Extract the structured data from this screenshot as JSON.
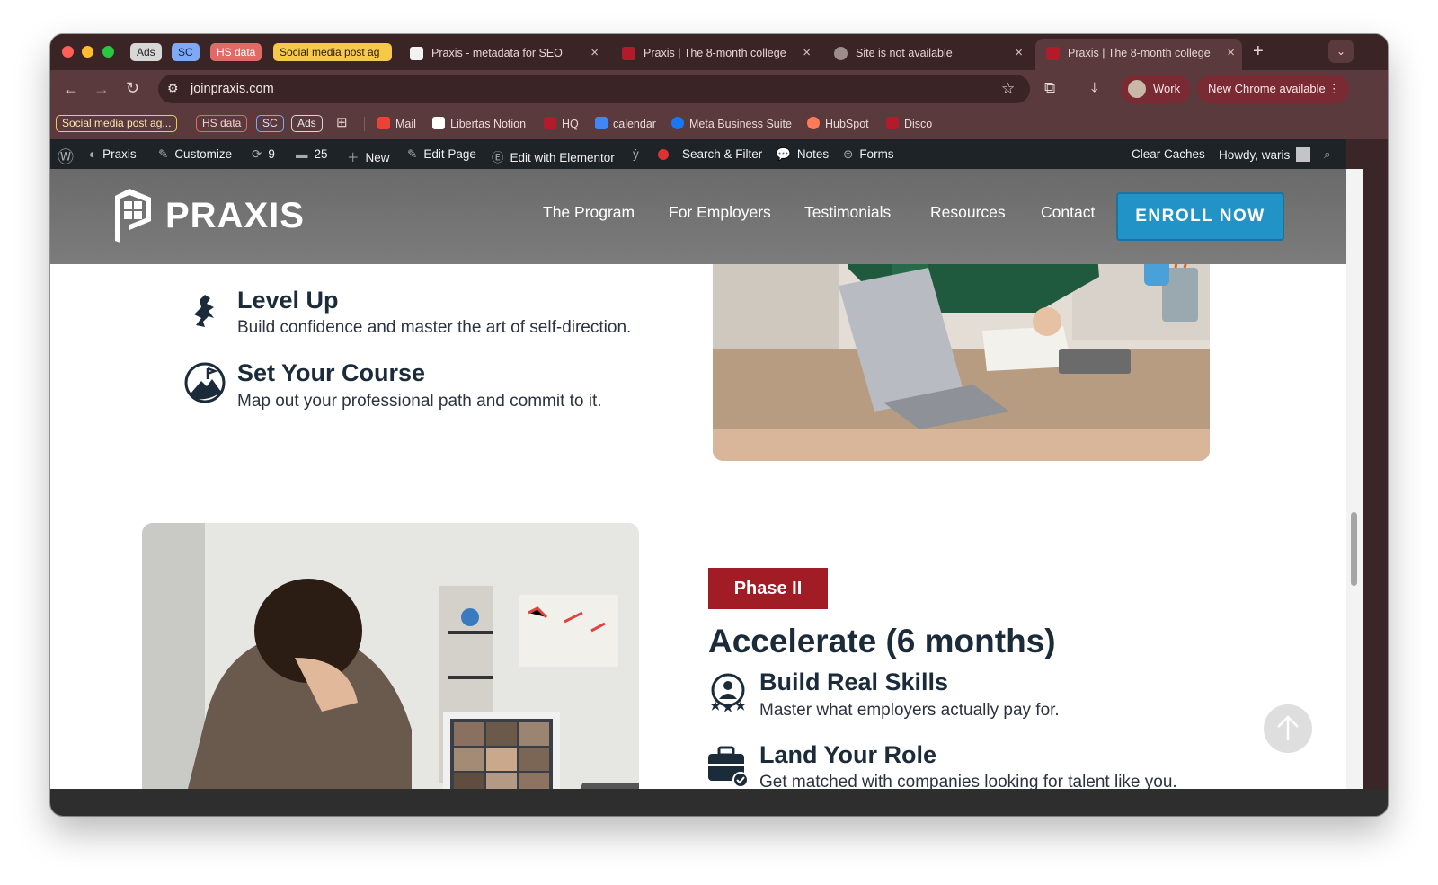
{
  "browser": {
    "tab_groups": [
      {
        "label": "Ads",
        "bg": "#d7d7d7",
        "fg": "#222"
      },
      {
        "label": "SC",
        "bg": "#7fa8f5",
        "fg": "#10234d"
      },
      {
        "label": "HS data",
        "bg": "#e06b66",
        "fg": "#fff"
      },
      {
        "label": "Social media post ag",
        "bg": "#f6c94c",
        "fg": "#2b2100"
      }
    ],
    "tabs": [
      {
        "title": "Praxis - metadata for SEO",
        "close": "×"
      },
      {
        "title": "Praxis | The 8-month college",
        "close": "×"
      },
      {
        "title": "Site is not available",
        "close": "×"
      },
      {
        "title": "Praxis | The 8-month college",
        "close": "×"
      }
    ],
    "new_tab": "+",
    "url": "joinpraxis.com",
    "profile_label": "Work",
    "update_label": "New Chrome available",
    "bookmark_chips": [
      {
        "label": "Social media post ag...",
        "color": "#f6c94c"
      },
      {
        "label": "HS data",
        "color": "#e06b66"
      },
      {
        "label": "SC",
        "color": "#7fa8f5"
      },
      {
        "label": "Ads",
        "color": "#d7d7d7"
      }
    ],
    "bookmarks": [
      {
        "label": "Mail",
        "color": "#ea4335"
      },
      {
        "label": "Libertas Notion",
        "color": "#ffffff"
      },
      {
        "label": "HQ",
        "color": "#b31b2a"
      },
      {
        "label": "calendar",
        "color": "#4285f4"
      },
      {
        "label": "Meta Business Suite",
        "color": "#1877f2"
      },
      {
        "label": "HubSpot",
        "color": "#ff7a59"
      },
      {
        "label": "Disco",
        "color": "#b31b2a"
      }
    ]
  },
  "wp_admin": {
    "site": "Praxis",
    "customize": "Customize",
    "updates": "9",
    "comments": "25",
    "new": "New",
    "edit_page": "Edit Page",
    "elementor": "Edit with Elementor",
    "search_filter": "Search & Filter",
    "notes": "Notes",
    "forms": "Forms",
    "clear_caches": "Clear Caches",
    "howdy": "Howdy, waris"
  },
  "site": {
    "logo": "PRAXIS",
    "nav": [
      "The Program",
      "For Employers",
      "Testimonials",
      "Resources",
      "Contact"
    ],
    "cta": "ENROLL NOW"
  },
  "phase1_features": [
    {
      "title": "Level Up",
      "desc": "Build confidence and master the art of self-direction.",
      "icon": "runner-icon"
    },
    {
      "title": "Set Your Course",
      "desc": "Map out your professional path and commit to it.",
      "icon": "summit-flag-icon"
    }
  ],
  "phase2": {
    "badge": "Phase II",
    "heading": "Accelerate (6 months)",
    "features": [
      {
        "title": "Build Real Skills",
        "desc": "Master what employers actually pay for.",
        "icon": "skills-badge-icon"
      },
      {
        "title": "Land Your Role",
        "desc": "Get matched with companies looking for talent like you.",
        "icon": "briefcase-check-icon"
      }
    ]
  },
  "colors": {
    "accent_red": "#a11c24",
    "cta_blue": "#2193c6",
    "heading": "#1c2b3a",
    "browser_chrome": "#5a3a3c"
  }
}
